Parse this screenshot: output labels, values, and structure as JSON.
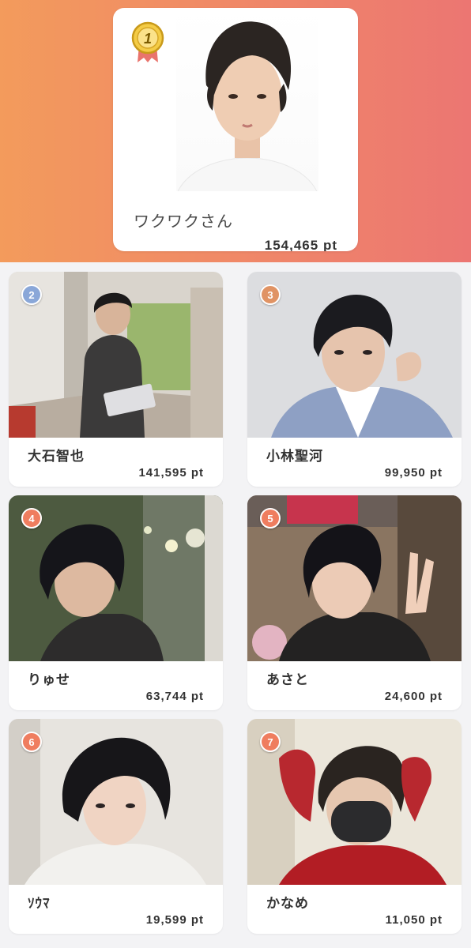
{
  "top": {
    "rank": "1",
    "name": "ワクワクさん",
    "points": "154,465 pt",
    "medal_color": "#e9b72f",
    "ribbon_color": "#e9746d"
  },
  "cards": [
    {
      "rank": "2",
      "name": "大石智也",
      "points": "141,595 pt",
      "badge_color": "#8aa7d8"
    },
    {
      "rank": "3",
      "name": "小林聖河",
      "points": "99,950 pt",
      "badge_color": "#e09364"
    },
    {
      "rank": "4",
      "name": "りゅせ",
      "points": "63,744 pt",
      "badge_color": "#ef7d5f"
    },
    {
      "rank": "5",
      "name": "あさと",
      "points": "24,600 pt",
      "badge_color": "#ef7d5f"
    },
    {
      "rank": "6",
      "name": "ｿｳﾏ",
      "points": "19,599 pt",
      "badge_color": "#ef7d5f"
    },
    {
      "rank": "7",
      "name": "かなめ",
      "points": "11,050 pt",
      "badge_color": "#ef7d5f"
    }
  ],
  "colors": {
    "hero_start": "#f39b5c",
    "hero_end": "#ec7672",
    "background": "#f3f3f5"
  },
  "icons": {
    "top_medal": "gold-medal-icon",
    "rank_badge": "rank-badge-icon"
  }
}
